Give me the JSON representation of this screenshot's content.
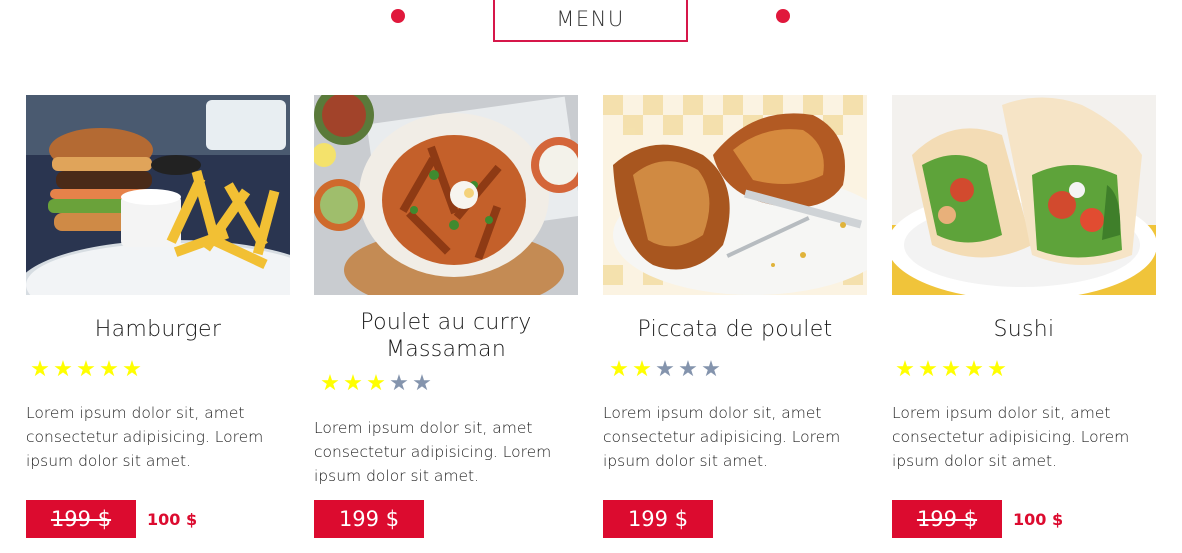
{
  "header": {
    "title": "MENU"
  },
  "colors": {
    "accent": "#dc0b2f",
    "star_on": "#ffff00",
    "star_off": "#8494ad"
  },
  "items": [
    {
      "name": "Hamburger",
      "image_icon": "hamburger-photo",
      "rating": 5,
      "max_rating": 5,
      "description": "Lorem ipsum dolor sit, amet consectetur adipisicing. Lorem ipsum dolor sit amet.",
      "price": "199 $",
      "price_struck": true,
      "sale_price": "100 $"
    },
    {
      "name": "Poulet au curry Massaman",
      "image_icon": "curry-photo",
      "rating": 3,
      "max_rating": 5,
      "description": "Lorem ipsum dolor sit, amet consectetur adipisicing. Lorem ipsum dolor sit amet.",
      "price": "199 $",
      "price_struck": false,
      "sale_price": ""
    },
    {
      "name": "Piccata de poulet",
      "image_icon": "roast-chicken-photo",
      "rating": 2,
      "max_rating": 5,
      "description": "Lorem ipsum dolor sit, amet consectetur adipisicing. Lorem ipsum dolor sit amet.",
      "price": "199 $",
      "price_struck": false,
      "sale_price": ""
    },
    {
      "name": "Sushi",
      "image_icon": "wrap-photo",
      "rating": 5,
      "max_rating": 5,
      "description": "Lorem ipsum dolor sit, amet consectetur adipisicing. Lorem ipsum dolor sit amet.",
      "price": "199 $",
      "price_struck": true,
      "sale_price": "100 $"
    }
  ]
}
